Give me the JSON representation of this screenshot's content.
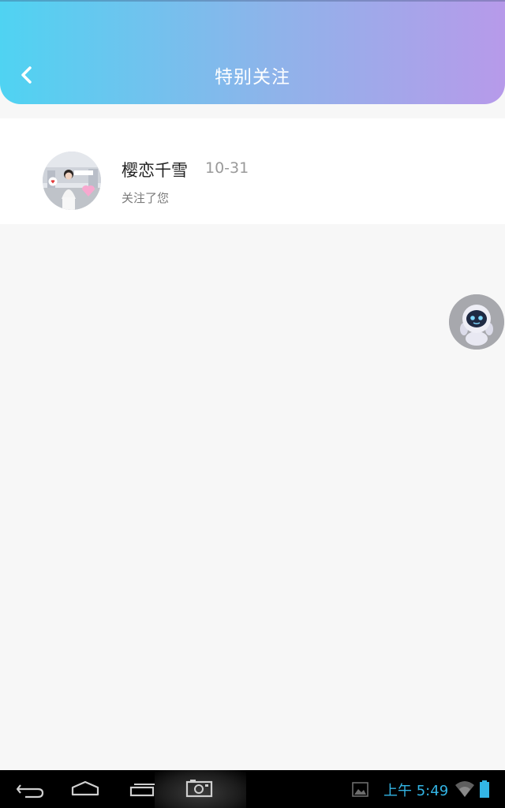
{
  "header": {
    "title": "特别关注",
    "back_icon": "chevron-left-icon"
  },
  "list": {
    "items": [
      {
        "name": "樱恋千雪",
        "date": "10-31",
        "description": "关注了您",
        "avatar": "user-avatar"
      }
    ]
  },
  "floating_button": {
    "icon": "robot-assistant-icon"
  },
  "system_bar": {
    "time": "上午 5:49",
    "icons": [
      "back-icon",
      "home-icon",
      "recent-apps-icon",
      "screenshot-camera-icon",
      "gallery-icon",
      "wifi-icon",
      "battery-icon"
    ]
  },
  "colors": {
    "header_gradient_start": "#4fd3f2",
    "header_gradient_end": "#b79aea",
    "clock": "#33b5e5"
  }
}
